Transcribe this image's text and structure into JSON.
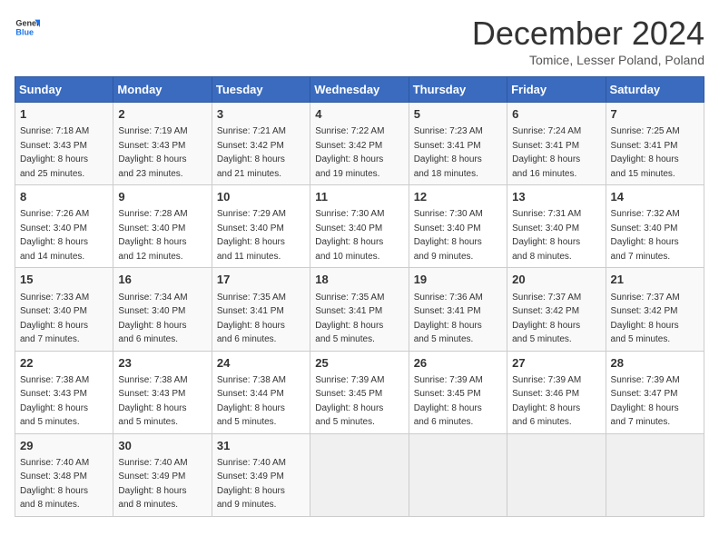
{
  "header": {
    "logo_line1": "General",
    "logo_line2": "Blue",
    "title": "December 2024",
    "subtitle": "Tomice, Lesser Poland, Poland"
  },
  "weekdays": [
    "Sunday",
    "Monday",
    "Tuesday",
    "Wednesday",
    "Thursday",
    "Friday",
    "Saturday"
  ],
  "weeks": [
    [
      {
        "day": "1",
        "info": "Sunrise: 7:18 AM\nSunset: 3:43 PM\nDaylight: 8 hours\nand 25 minutes."
      },
      {
        "day": "2",
        "info": "Sunrise: 7:19 AM\nSunset: 3:43 PM\nDaylight: 8 hours\nand 23 minutes."
      },
      {
        "day": "3",
        "info": "Sunrise: 7:21 AM\nSunset: 3:42 PM\nDaylight: 8 hours\nand 21 minutes."
      },
      {
        "day": "4",
        "info": "Sunrise: 7:22 AM\nSunset: 3:42 PM\nDaylight: 8 hours\nand 19 minutes."
      },
      {
        "day": "5",
        "info": "Sunrise: 7:23 AM\nSunset: 3:41 PM\nDaylight: 8 hours\nand 18 minutes."
      },
      {
        "day": "6",
        "info": "Sunrise: 7:24 AM\nSunset: 3:41 PM\nDaylight: 8 hours\nand 16 minutes."
      },
      {
        "day": "7",
        "info": "Sunrise: 7:25 AM\nSunset: 3:41 PM\nDaylight: 8 hours\nand 15 minutes."
      }
    ],
    [
      {
        "day": "8",
        "info": "Sunrise: 7:26 AM\nSunset: 3:40 PM\nDaylight: 8 hours\nand 14 minutes."
      },
      {
        "day": "9",
        "info": "Sunrise: 7:28 AM\nSunset: 3:40 PM\nDaylight: 8 hours\nand 12 minutes."
      },
      {
        "day": "10",
        "info": "Sunrise: 7:29 AM\nSunset: 3:40 PM\nDaylight: 8 hours\nand 11 minutes."
      },
      {
        "day": "11",
        "info": "Sunrise: 7:30 AM\nSunset: 3:40 PM\nDaylight: 8 hours\nand 10 minutes."
      },
      {
        "day": "12",
        "info": "Sunrise: 7:30 AM\nSunset: 3:40 PM\nDaylight: 8 hours\nand 9 minutes."
      },
      {
        "day": "13",
        "info": "Sunrise: 7:31 AM\nSunset: 3:40 PM\nDaylight: 8 hours\nand 8 minutes."
      },
      {
        "day": "14",
        "info": "Sunrise: 7:32 AM\nSunset: 3:40 PM\nDaylight: 8 hours\nand 7 minutes."
      }
    ],
    [
      {
        "day": "15",
        "info": "Sunrise: 7:33 AM\nSunset: 3:40 PM\nDaylight: 8 hours\nand 7 minutes."
      },
      {
        "day": "16",
        "info": "Sunrise: 7:34 AM\nSunset: 3:40 PM\nDaylight: 8 hours\nand 6 minutes."
      },
      {
        "day": "17",
        "info": "Sunrise: 7:35 AM\nSunset: 3:41 PM\nDaylight: 8 hours\nand 6 minutes."
      },
      {
        "day": "18",
        "info": "Sunrise: 7:35 AM\nSunset: 3:41 PM\nDaylight: 8 hours\nand 5 minutes."
      },
      {
        "day": "19",
        "info": "Sunrise: 7:36 AM\nSunset: 3:41 PM\nDaylight: 8 hours\nand 5 minutes."
      },
      {
        "day": "20",
        "info": "Sunrise: 7:37 AM\nSunset: 3:42 PM\nDaylight: 8 hours\nand 5 minutes."
      },
      {
        "day": "21",
        "info": "Sunrise: 7:37 AM\nSunset: 3:42 PM\nDaylight: 8 hours\nand 5 minutes."
      }
    ],
    [
      {
        "day": "22",
        "info": "Sunrise: 7:38 AM\nSunset: 3:43 PM\nDaylight: 8 hours\nand 5 minutes."
      },
      {
        "day": "23",
        "info": "Sunrise: 7:38 AM\nSunset: 3:43 PM\nDaylight: 8 hours\nand 5 minutes."
      },
      {
        "day": "24",
        "info": "Sunrise: 7:38 AM\nSunset: 3:44 PM\nDaylight: 8 hours\nand 5 minutes."
      },
      {
        "day": "25",
        "info": "Sunrise: 7:39 AM\nSunset: 3:45 PM\nDaylight: 8 hours\nand 5 minutes."
      },
      {
        "day": "26",
        "info": "Sunrise: 7:39 AM\nSunset: 3:45 PM\nDaylight: 8 hours\nand 6 minutes."
      },
      {
        "day": "27",
        "info": "Sunrise: 7:39 AM\nSunset: 3:46 PM\nDaylight: 8 hours\nand 6 minutes."
      },
      {
        "day": "28",
        "info": "Sunrise: 7:39 AM\nSunset: 3:47 PM\nDaylight: 8 hours\nand 7 minutes."
      }
    ],
    [
      {
        "day": "29",
        "info": "Sunrise: 7:40 AM\nSunset: 3:48 PM\nDaylight: 8 hours\nand 8 minutes."
      },
      {
        "day": "30",
        "info": "Sunrise: 7:40 AM\nSunset: 3:49 PM\nDaylight: 8 hours\nand 8 minutes."
      },
      {
        "day": "31",
        "info": "Sunrise: 7:40 AM\nSunset: 3:49 PM\nDaylight: 8 hours\nand 9 minutes."
      },
      {
        "day": "",
        "info": ""
      },
      {
        "day": "",
        "info": ""
      },
      {
        "day": "",
        "info": ""
      },
      {
        "day": "",
        "info": ""
      }
    ]
  ]
}
